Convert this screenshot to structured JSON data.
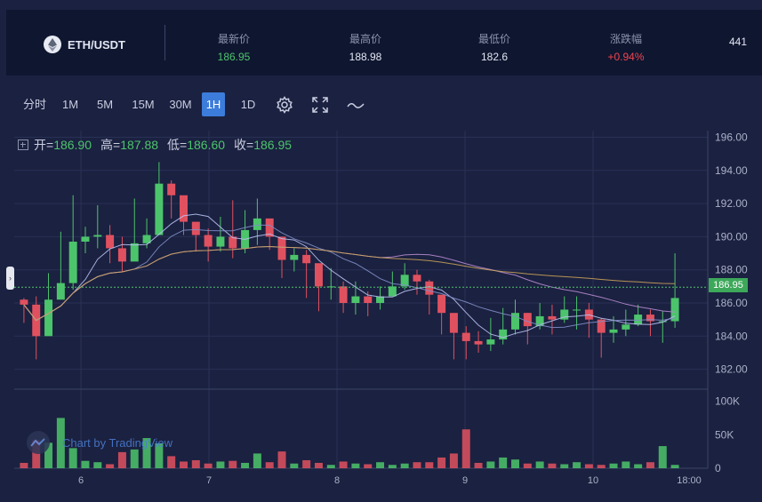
{
  "header": {
    "pair": "ETH/USDT",
    "stats": [
      {
        "label": "最新价",
        "value": "186.95",
        "tone": "green"
      },
      {
        "label": "最高价",
        "value": "188.98",
        "tone": "normal"
      },
      {
        "label": "最低价",
        "value": "182.6",
        "tone": "normal"
      },
      {
        "label": "涨跌幅",
        "value": "+0.94%",
        "tone": "red"
      },
      {
        "label": "",
        "value": "441",
        "tone": "normal"
      }
    ]
  },
  "toolbar": {
    "intervals": [
      "分时",
      "1M",
      "5M",
      "15M",
      "30M",
      "1H",
      "1D"
    ],
    "active": "1H",
    "icons": [
      "gear-icon",
      "fullscreen-icon",
      "line-style-icon"
    ]
  },
  "ohlc": {
    "open_label": "开=",
    "open": "186.90",
    "high_label": "高=",
    "high": "187.88",
    "low_label": "低=",
    "low": "186.60",
    "close_label": "收=",
    "close": "186.95"
  },
  "last_price": "186.95",
  "watermark": "Chart by TradingView",
  "colors": {
    "up": "#4cc46b",
    "down": "#e05160",
    "ma5": "#b9c1f2",
    "ma10": "#7f8ec8",
    "ma30": "#b58bd0",
    "ma60": "#c9a15a"
  },
  "chart_data": {
    "type": "candlestick",
    "price_axis": {
      "ticks": [
        182,
        184,
        186,
        188,
        190,
        192,
        194,
        196
      ],
      "ylim": [
        180.8,
        196.4
      ],
      "tick_labels": [
        "182.00",
        "184.00",
        "186.00",
        "188.00",
        "190.00",
        "192.00",
        "194.00",
        "196.00"
      ]
    },
    "volume_axis": {
      "ticks": [
        0,
        50000,
        100000
      ],
      "tick_labels": [
        "0",
        "50K",
        "100K"
      ],
      "ylim": [
        0,
        110000
      ]
    },
    "time_axis": {
      "labels": [
        "6",
        "7",
        "8",
        "9",
        "10",
        "18:00"
      ]
    },
    "closes": [
      185.9,
      184.0,
      186.2,
      187.2,
      189.7,
      190.0,
      190.1,
      189.3,
      188.5,
      189.6,
      190.1,
      193.2,
      192.5,
      190.9,
      190.1,
      189.4,
      190.0,
      189.3,
      190.4,
      191.1,
      190.0,
      188.6,
      188.9,
      188.4,
      187.0,
      187.0,
      186.0,
      186.4,
      186.0,
      186.4,
      187.0,
      187.7,
      187.3,
      186.5,
      185.4,
      184.2,
      183.7,
      183.5,
      183.8,
      184.4,
      185.4,
      184.6,
      185.2,
      185.0,
      185.6,
      185.6,
      185.0,
      184.2,
      184.4,
      184.7,
      185.3,
      184.9,
      184.9,
      186.3
    ],
    "highs": [
      186.3,
      186.4,
      187.8,
      190.3,
      192.5,
      190.6,
      191.9,
      190.7,
      190.0,
      192.3,
      191.1,
      194.5,
      193.4,
      192.2,
      190.8,
      190.5,
      191.2,
      192.2,
      191.6,
      192.3,
      190.8,
      189.7,
      189.3,
      189.2,
      187.8,
      188.1,
      187.3,
      187.3,
      186.7,
      187.0,
      187.9,
      188.4,
      188.0,
      187.4,
      186.3,
      185.0,
      184.6,
      184.3,
      185.1,
      185.7,
      186.2,
      185.4,
      186.0,
      185.9,
      186.4,
      186.4,
      186.0,
      185.1,
      185.2,
      185.6,
      185.9,
      185.6,
      185.5,
      189.0
    ],
    "lows": [
      184.8,
      182.6,
      185.5,
      186.4,
      186.8,
      189.0,
      189.3,
      188.4,
      187.9,
      188.6,
      189.3,
      190.6,
      191.1,
      190.1,
      189.1,
      188.5,
      189.1,
      188.7,
      189.0,
      189.5,
      189.2,
      187.5,
      187.9,
      186.3,
      185.5,
      186.2,
      185.4,
      185.3,
      185.2,
      185.6,
      186.5,
      186.8,
      186.5,
      185.3,
      184.1,
      182.6,
      182.6,
      183.0,
      183.1,
      183.5,
      184.1,
      183.5,
      184.4,
      184.1,
      184.8,
      184.4,
      183.9,
      182.7,
      183.6,
      184.0,
      184.6,
      184.0,
      183.6,
      184.5
    ],
    "volumes": [
      8000,
      42000,
      38000,
      75000,
      30000,
      11000,
      9000,
      6000,
      24000,
      28000,
      45000,
      37000,
      18000,
      10000,
      12000,
      7000,
      10000,
      11000,
      8000,
      22000,
      9000,
      25000,
      7000,
      12000,
      8000,
      5000,
      10000,
      7000,
      6000,
      9000,
      5000,
      7000,
      9000,
      9000,
      16000,
      22000,
      58000,
      8000,
      10000,
      16000,
      13000,
      7000,
      10000,
      7000,
      6000,
      9000,
      6000,
      5000,
      7000,
      10000,
      6000,
      9000,
      33000,
      5000
    ]
  }
}
